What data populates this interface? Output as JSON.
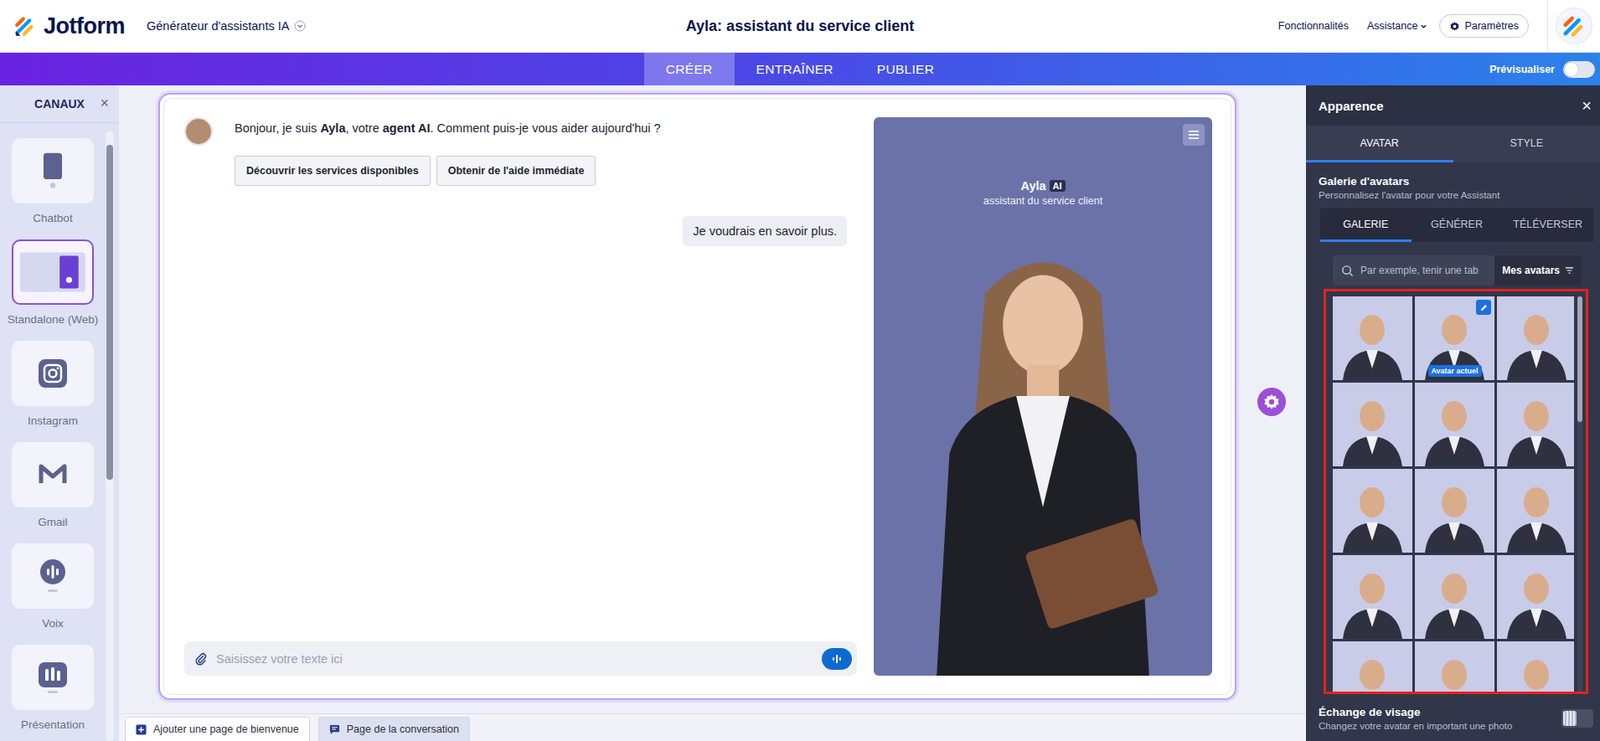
{
  "header": {
    "logo": "Jotform",
    "product": "Générateur d'assistants IA",
    "title": "Ayla: assistant du service client",
    "nav": [
      {
        "label": "Fonctionnalités",
        "dropdown": false
      },
      {
        "label": "Assistance",
        "dropdown": true
      }
    ],
    "settings": "Paramètres"
  },
  "tabs": [
    {
      "label": "CRÉER",
      "selected": true
    },
    {
      "label": "ENTRAÎNER",
      "selected": false
    },
    {
      "label": "PUBLIER",
      "selected": false
    }
  ],
  "preview": {
    "label": "Prévisualiser",
    "on": false
  },
  "channels": {
    "title": "CANAUX",
    "close": "×",
    "items": [
      {
        "label": "Chatbot",
        "kind": "chatbot",
        "selected": false
      },
      {
        "label": "Standalone (Web)",
        "kind": "standalone",
        "selected": true
      },
      {
        "label": "Instagram",
        "kind": "instagram",
        "selected": false
      },
      {
        "label": "Gmail",
        "kind": "gmail",
        "selected": false
      },
      {
        "label": "Voix",
        "kind": "voice",
        "selected": false
      },
      {
        "label": "Présentation",
        "kind": "presentation",
        "selected": false
      }
    ]
  },
  "chat": {
    "bot_message": [
      {
        "text": "Bonjour, je suis ",
        "bold": false
      },
      {
        "text": "Ayla",
        "bold": true
      },
      {
        "text": ", votre ",
        "bold": false
      },
      {
        "text": "agent AI",
        "bold": true
      },
      {
        "text": ". Comment puis-je vous aider aujourd'hui ?",
        "bold": false
      }
    ],
    "quick_replies": [
      "Découvrir les services disponibles",
      "Obtenir de l'aide immédiate"
    ],
    "user_message": "Je voudrais en savoir plus.",
    "input_placeholder": "Saisissez votre texte ici"
  },
  "agent_card": {
    "name": "Ayla",
    "badge": "AI",
    "role": "assistant du service client"
  },
  "bottom_tabs": [
    {
      "label": "Ajouter une page de bienvenue",
      "kind": "add",
      "selected": false
    },
    {
      "label": "Page de la conversation",
      "kind": "conversation",
      "selected": true
    }
  ],
  "appearance": {
    "title": "Apparence",
    "close": "×",
    "tabs": [
      {
        "label": "AVATAR",
        "selected": true
      },
      {
        "label": "STYLE",
        "selected": false
      }
    ],
    "gallery_title": "Galerie d'avatars",
    "gallery_subtitle": "Personnalisez l'avatar pour votre Assistant",
    "sub_tabs": [
      {
        "label": "GALERIE",
        "selected": true
      },
      {
        "label": "GÉNÉRER",
        "selected": false
      },
      {
        "label": "TÉLÉVERSER",
        "selected": false
      }
    ],
    "search_placeholder": "Par exemple, tenir une tab",
    "filter": "Mes avatars",
    "current_badge": "Avatar actuel",
    "avatars": [
      {
        "selected": false
      },
      {
        "selected": true
      },
      {
        "selected": false
      },
      {
        "selected": false
      },
      {
        "selected": false
      },
      {
        "selected": false
      },
      {
        "selected": false
      },
      {
        "selected": false
      },
      {
        "selected": false
      },
      {
        "selected": false
      },
      {
        "selected": false
      },
      {
        "selected": false
      },
      {
        "selected": false
      },
      {
        "selected": false
      },
      {
        "selected": false
      }
    ],
    "face_swap": {
      "title": "Échange de visage",
      "subtitle": "Changez votre avatar en important une photo",
      "on": false
    }
  }
}
